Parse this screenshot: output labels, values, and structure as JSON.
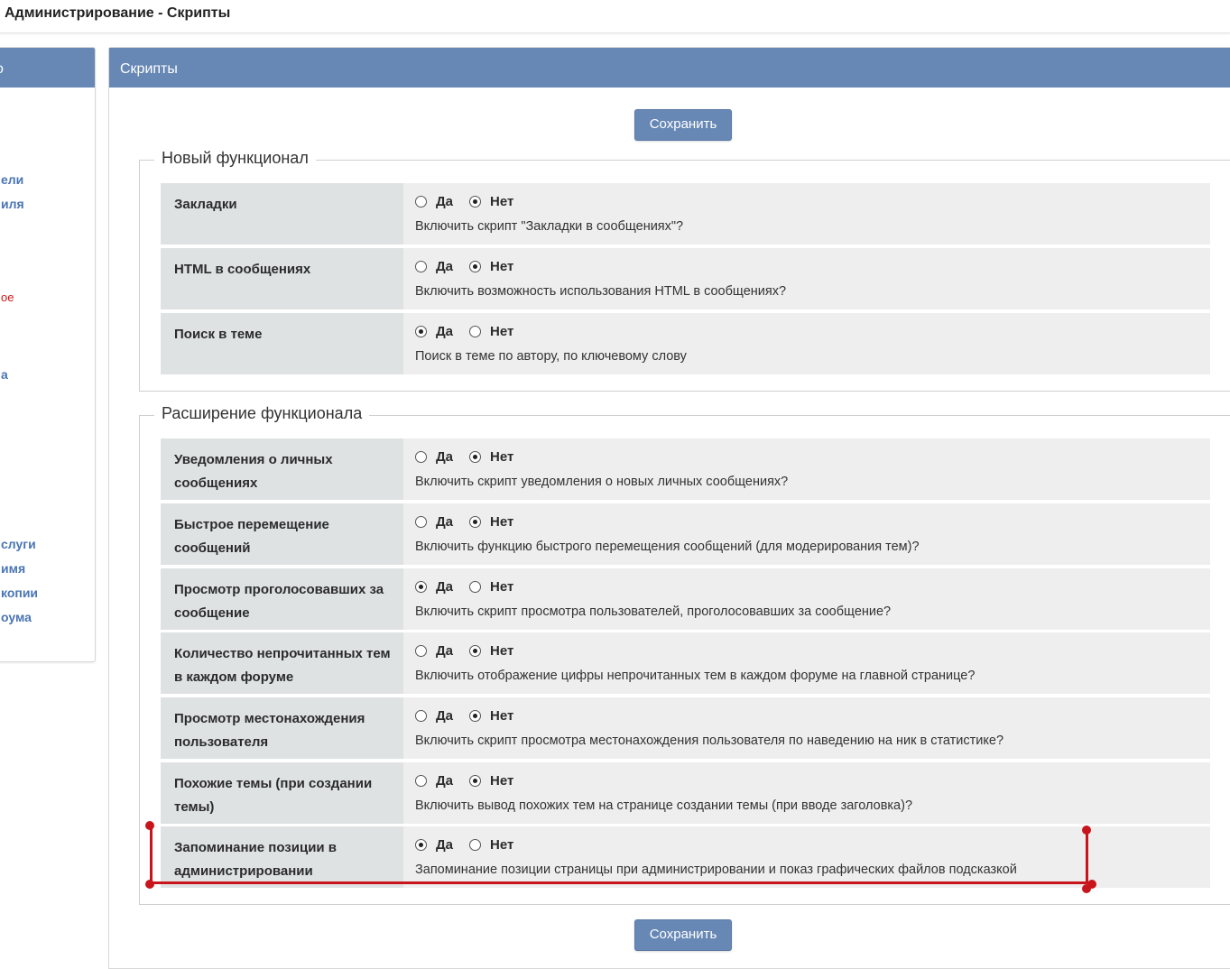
{
  "page_title": "Администрирование - Скрипты",
  "sidebar": {
    "header": "о",
    "links": [
      {
        "text": "ели",
        "red": false
      },
      {
        "text": "иля",
        "red": false
      },
      {
        "text": "ое",
        "red": true
      },
      {
        "text": "а",
        "red": false
      },
      {
        "text": "слуги",
        "red": false
      },
      {
        "text": "имя",
        "red": false
      },
      {
        "text": "копии",
        "red": false
      },
      {
        "text": "оума",
        "red": false
      }
    ]
  },
  "panel": {
    "title": "Скрипты",
    "save_label": "Сохранить"
  },
  "options_labels": {
    "yes": "Да",
    "no": "Нет"
  },
  "groups": [
    {
      "legend": "Новый функционал",
      "rows": [
        {
          "label": "Закладки",
          "selected": "no",
          "desc": "Включить скрипт \"Закладки в сообщениях\"?"
        },
        {
          "label": "HTML в сообщениях",
          "selected": "no",
          "desc": "Включить возможность использования HTML в сообщениях?"
        },
        {
          "label": "Поиск в теме",
          "selected": "yes",
          "desc": "Поиск в теме по автору, по ключевому слову"
        }
      ]
    },
    {
      "legend": "Расширение функционала",
      "rows": [
        {
          "label": "Уведомления о личных сообщениях",
          "selected": "no",
          "desc": "Включить скрипт уведомления о новых личных сообщениях?"
        },
        {
          "label": "Быстрое перемещение сообщений",
          "selected": "no",
          "desc": "Включить функцию быстрого перемещения сообщений (для модерирования тем)?"
        },
        {
          "label": "Просмотр проголосовавших за сообщение",
          "selected": "yes",
          "desc": "Включить скрипт просмотра пользователей, проголосовавших за сообщение?"
        },
        {
          "label": "Количество непрочитанных тем в каждом форуме",
          "selected": "no",
          "desc": "Включить отображение цифры непрочитанных тем в каждом форуме на главной странице?"
        },
        {
          "label": "Просмотр местонахождения пользователя",
          "selected": "no",
          "desc": "Включить скрипт просмотра местонахождения пользователя по наведению на ник в статистике?"
        },
        {
          "label": "Похожие темы (при создании темы)",
          "selected": "no",
          "desc": "Включить вывод похожих тем на странице создании темы (при вводе заголовка)?"
        },
        {
          "label": "Запоминание позиции в администрировании",
          "selected": "yes",
          "desc": "Запоминание позиции страницы при администрировании и показ графических файлов подсказкой"
        }
      ]
    }
  ],
  "colors": {
    "header_blue": "#6788b5",
    "annotation_red": "#c8141b"
  }
}
